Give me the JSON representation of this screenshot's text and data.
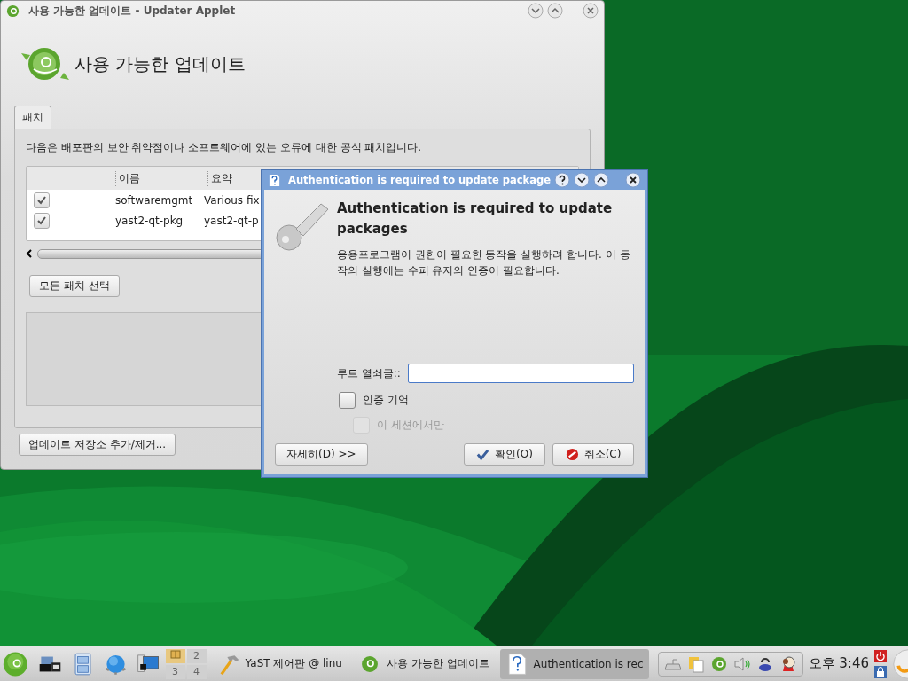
{
  "main_window": {
    "title": "사용 가능한 업데이트 - Updater Applet",
    "heading": "사용 가능한 업데이트",
    "tabs": [
      {
        "label": "패치",
        "selected": true
      }
    ],
    "description": "다음은 배포판의 보안 취약점이나 소프트웨어에 있는 오류에 대한 공식 패치입니다.",
    "table": {
      "columns": [
        "이름",
        "요약"
      ],
      "rows": [
        {
          "checked": true,
          "name": "softwaremgmt",
          "summary": "Various fix"
        },
        {
          "checked": true,
          "name": "yast2-qt-pkg",
          "summary": "yast2-qt-p"
        }
      ]
    },
    "select_all_button": "모든 패치 선택",
    "repo_button": "업데이트 저장소 추가/제거..."
  },
  "dialog": {
    "title": "Authentication is required to update package",
    "heading": "Authentication is required to update packages",
    "message": "응용프로그램이 권한이 필요한 동작을 실행하려 합니다. 이 동작의 실행에는 수퍼 유저의 인증이 필요합니다.",
    "password_label": "루트 열쇠글::",
    "options": [
      {
        "label": "인증 기억",
        "checked": false,
        "disabled": false,
        "children": [
          {
            "label": "이 세션에서만",
            "checked": false,
            "disabled": true
          }
        ]
      }
    ],
    "buttons": [
      {
        "label": "자세히(D) >>",
        "kind": "details"
      },
      {
        "label": "확인(O)",
        "kind": "ok"
      },
      {
        "label": "취소(C)",
        "kind": "cancel"
      }
    ]
  },
  "taskbar": {
    "pager": [
      {
        "selected": true
      },
      {
        "label": "2",
        "selected": false
      },
      {
        "label": "3",
        "selected": false
      },
      {
        "label": "4",
        "selected": false
      }
    ],
    "tasks": [
      {
        "label": "YaST 제어판 @ linu",
        "kind": "tool",
        "selected": false
      },
      {
        "label": "사용 가능한 업데이트",
        "kind": "logo",
        "selected": false
      },
      {
        "label": "Authentication is rec",
        "kind": "question",
        "selected": true
      }
    ],
    "clock": "오후 3:46"
  }
}
